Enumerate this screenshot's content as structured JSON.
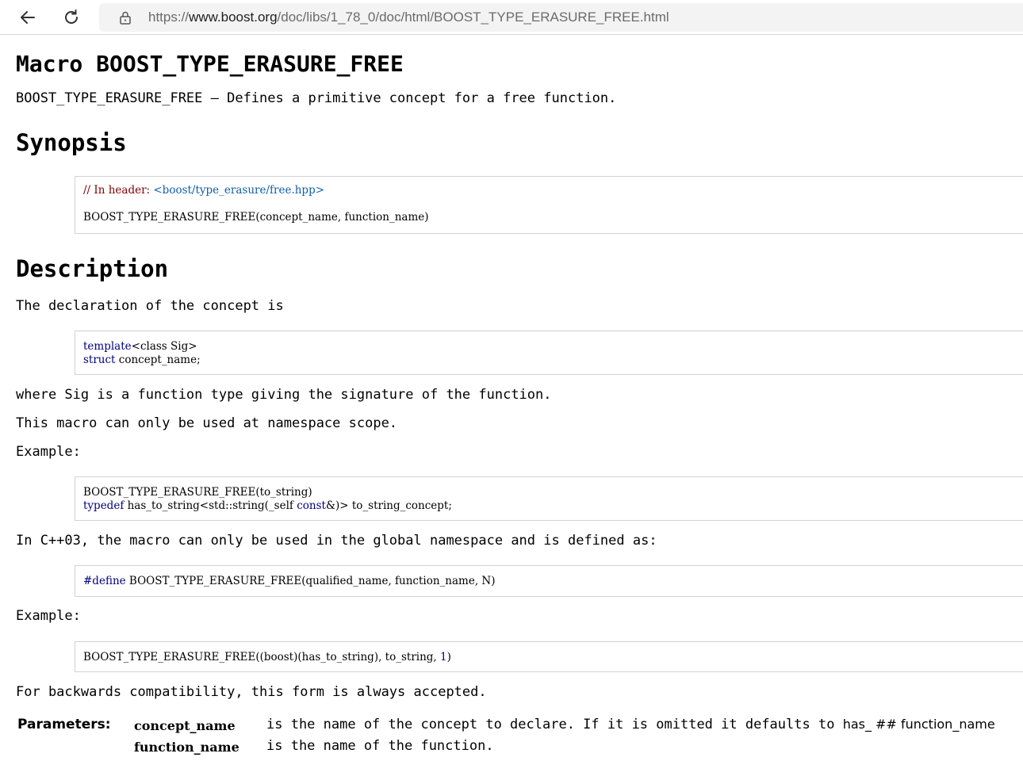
{
  "browser": {
    "url_scheme": "https://",
    "url_host": "www.boost.org",
    "url_path": "/doc/libs/1_78_0/doc/html/BOOST_TYPE_ERASURE_FREE.html"
  },
  "doc": {
    "title": "Macro BOOST_TYPE_ERASURE_FREE",
    "refname": "BOOST_TYPE_ERASURE_FREE — Defines a primitive concept for a free function.",
    "synopsis": {
      "heading": "Synopsis",
      "comment": "// In header: ",
      "header_link": "<boost/type_erasure/free.hpp>",
      "macro_line": "BOOST_TYPE_ERASURE_FREE(concept_name, function_name)"
    },
    "description": {
      "heading": "Description",
      "p1": "The declaration of the concept is",
      "code1_kw1": "template",
      "code1_rest1": "<class Sig>",
      "code1_kw2": "struct",
      "code1_rest2": " concept_name;",
      "p2": "where Sig is a function type giving the signature of the function.",
      "p3": "This macro can only be used at namespace scope.",
      "example_label_1": "Example:",
      "code2_line1": "BOOST_TYPE_ERASURE_FREE(to_string)",
      "code2_kw": "typedef",
      "code2_rest": " has_to_string<std::string(_self ",
      "code2_kw2": "const",
      "code2_tail": "&)> to_string_concept;",
      "p4": "In C++03, the macro can only be used in the global namespace and is defined as:",
      "code3_kw": "#define",
      "code3_rest": " BOOST_TYPE_ERASURE_FREE(qualified_name, function_name, N)",
      "example_label_2": "Example:",
      "code4_rest": "BOOST_TYPE_ERASURE_FREE((boost)(has_to_string), to_string, ",
      "code4_num": "1",
      "code4_tail": ")",
      "p5": "For backwards compatibility, this form is always accepted."
    },
    "parameters": {
      "label": "Parameters:",
      "items": [
        {
          "name": "concept_name",
          "desc": "is the name of the concept to declare. If it is omitted it defaults to ",
          "desc_code": "has_ ## function_name"
        },
        {
          "name": "function_name",
          "desc": "is the name of the function."
        }
      ]
    }
  }
}
